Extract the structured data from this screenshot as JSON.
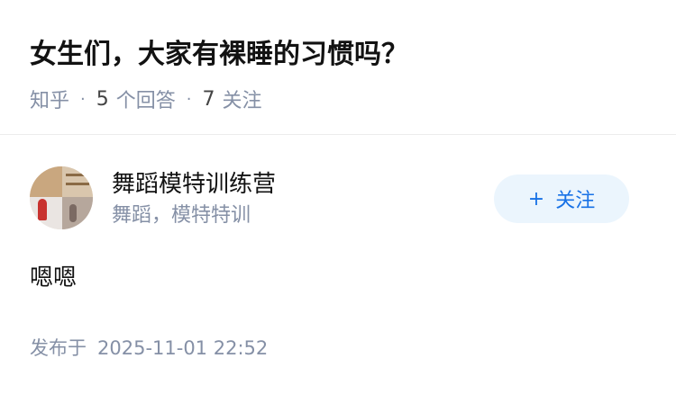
{
  "question": {
    "title": "女生们，大家有裸睡的习惯吗？",
    "meta": {
      "source": "知乎",
      "answer_count": "5",
      "answer_label": "个回答",
      "follower_count": "7",
      "follower_label": "关注",
      "separator": "·"
    }
  },
  "answer": {
    "author": {
      "name": "舞蹈模特训练营",
      "headline": "舞蹈，模特特训",
      "avatar_icon": "avatar-photo"
    },
    "follow_button": {
      "icon": "+",
      "label": "关注"
    },
    "content": "嗯嗯",
    "published_label": "发布于",
    "published_time": "2025-11-01 22:52"
  },
  "colors": {
    "title": "#121212",
    "meta_gray": "#8590a6",
    "follow_bg": "#ebf5fd",
    "follow_text": "#1771e6",
    "divider": "#ececec"
  }
}
